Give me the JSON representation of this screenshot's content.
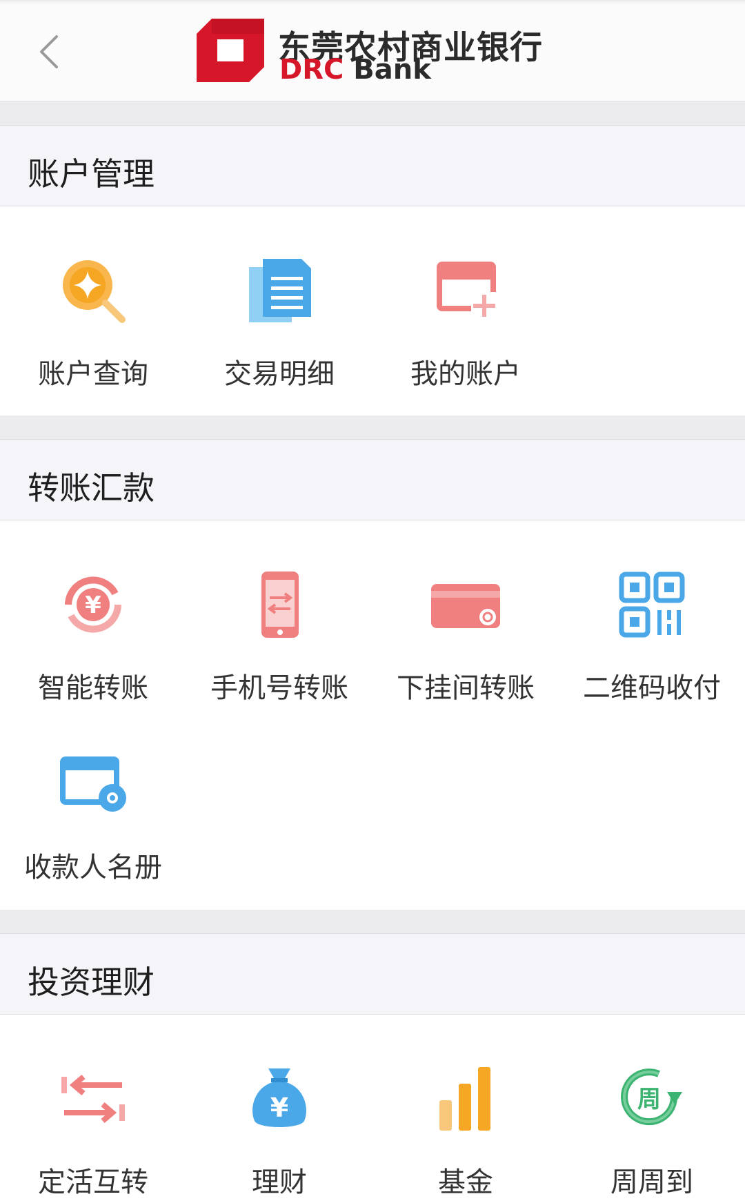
{
  "header": {
    "back_icon": "chevron-left-icon",
    "logo_cn": "东莞农村商业银行",
    "logo_en_prefix": "DRC",
    "logo_en_suffix": "Bank",
    "brand_color": "#d6172a"
  },
  "sections": [
    {
      "title": "账户管理",
      "items": [
        {
          "label": "账户查询",
          "icon": "account-query-icon",
          "color": "#f5a623"
        },
        {
          "label": "交易明细",
          "icon": "transaction-details-icon",
          "color": "#4aa8e8"
        },
        {
          "label": "我的账户",
          "icon": "my-account-icon",
          "color": "#f08080"
        }
      ]
    },
    {
      "title": "转账汇款",
      "items": [
        {
          "label": "智能转账",
          "icon": "smart-transfer-icon",
          "color": "#f07a7a"
        },
        {
          "label": "手机号转账",
          "icon": "phone-transfer-icon",
          "color": "#f07a7a"
        },
        {
          "label": "下挂间转账",
          "icon": "linked-card-transfer-icon",
          "color": "#f07a7a"
        },
        {
          "label": "二维码收付",
          "icon": "qr-code-icon",
          "color": "#4aa8e8"
        },
        {
          "label": "收款人名册",
          "icon": "payee-list-icon",
          "color": "#4aa8e8"
        }
      ]
    },
    {
      "title": "投资理财",
      "items": [
        {
          "label": "定活互转",
          "icon": "fixed-demand-transfer-icon",
          "color": "#f07a7a"
        },
        {
          "label": "理财",
          "icon": "wealth-bag-icon",
          "color": "#4aa8e8"
        },
        {
          "label": "基金",
          "icon": "fund-bars-icon",
          "color": "#f5a623"
        },
        {
          "label": "周周到",
          "icon": "weekly-cycle-icon",
          "color": "#3cb371"
        }
      ]
    }
  ]
}
